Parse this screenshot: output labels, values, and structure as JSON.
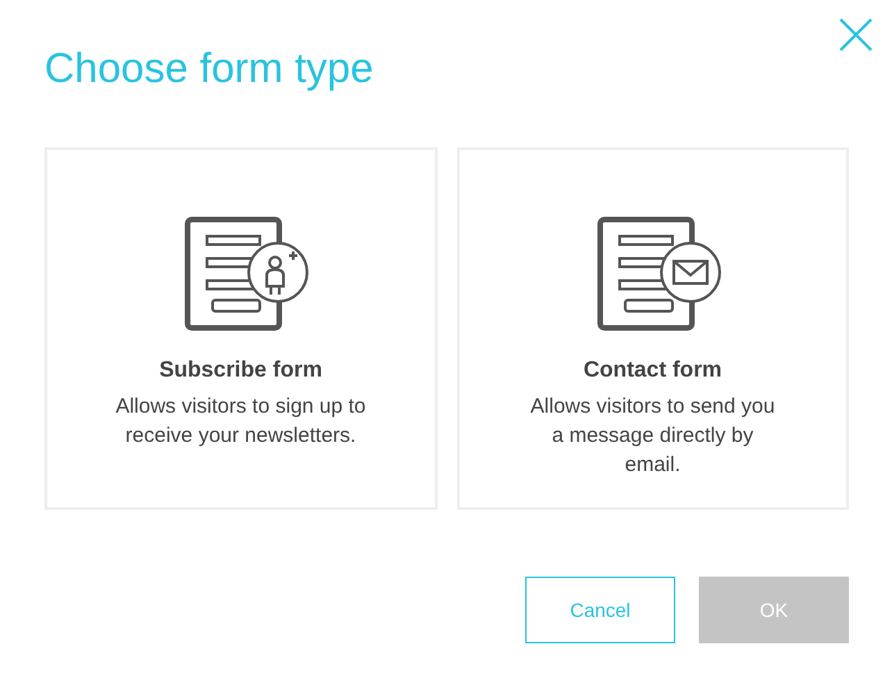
{
  "dialog": {
    "title": "Choose form type"
  },
  "cards": [
    {
      "kind": "subscribe",
      "title": "Subscribe form",
      "description": "Allows visitors to sign up to receive your newsletters."
    },
    {
      "kind": "contact",
      "title": "Contact form",
      "description": "Allows visitors to send you a message directly by email."
    }
  ],
  "buttons": [
    {
      "label": "Cancel",
      "kind": "secondary",
      "disabled": false
    },
    {
      "label": "OK",
      "kind": "primary",
      "disabled": true
    }
  ]
}
